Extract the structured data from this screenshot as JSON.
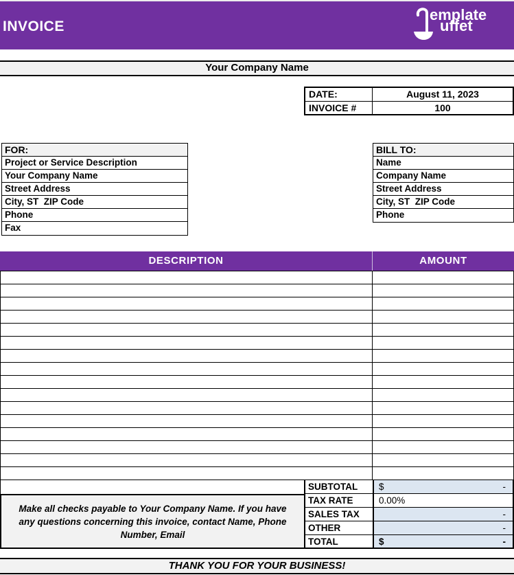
{
  "header": {
    "title": "INVOICE",
    "logo": {
      "line1": "emplate",
      "line2": "uffet",
      "icon": "ladle-icon"
    }
  },
  "company_bar": {
    "text": "Your Company Name"
  },
  "invoice_meta": {
    "rows": [
      {
        "label": "DATE:",
        "value": "August 11, 2023"
      },
      {
        "label": "INVOICE #",
        "value": "100"
      }
    ]
  },
  "for_section": {
    "header": "FOR:",
    "rows": [
      "Project or Service Description",
      "Your Company Name",
      "Street Address",
      "City, ST  ZIP Code",
      "Phone",
      "Fax"
    ]
  },
  "bill_to_section": {
    "header": "BILL TO:",
    "rows": [
      "Name",
      "Company Name",
      "Street Address",
      "City, ST  ZIP Code",
      "Phone"
    ]
  },
  "items_table": {
    "columns": [
      "DESCRIPTION",
      "AMOUNT"
    ],
    "empty_row_count": 16
  },
  "totals": {
    "subtotal": {
      "label": "SUBTOTAL",
      "currency": "$",
      "amount": "-"
    },
    "tax_rate": {
      "label": "TAX RATE",
      "value": "0.00%"
    },
    "sales_tax": {
      "label": "SALES TAX",
      "amount": "-"
    },
    "other": {
      "label": "OTHER",
      "amount": "-"
    },
    "total": {
      "label": "TOTAL",
      "currency": "$",
      "amount": "-"
    }
  },
  "note": {
    "text": "Make all checks payable to Your Company Name. If you have any questions concerning this invoice, contact Name, Phone Number, Email"
  },
  "footer": {
    "text": "THANK YOU FOR YOUR BUSINESS!"
  },
  "colors": {
    "accent_purple": "#7030A0",
    "section_gray": "#F2F2F2",
    "amount_blue": "#DCE6F1"
  }
}
